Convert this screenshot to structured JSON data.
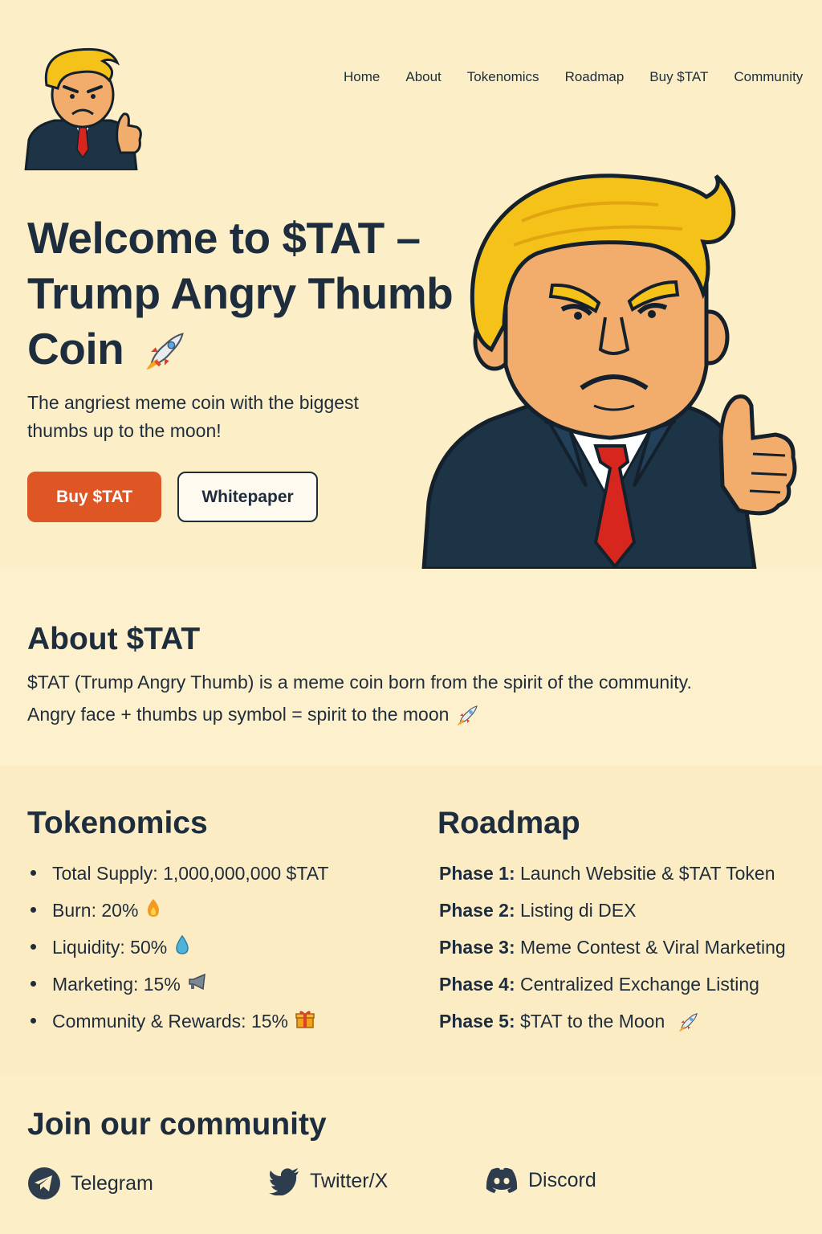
{
  "nav": {
    "items": [
      "Home",
      "About",
      "Tokenomics",
      "Roadmap",
      "Buy $TAT",
      "Community"
    ]
  },
  "hero": {
    "title": "Welcome to $TAT – Trump Angry Thumb Coin",
    "title_emoji": "rocket-icon",
    "subtitle": "The angriest meme coin with the biggest thumbs up to the moon!",
    "buy_label": "Buy $TAT",
    "whitepaper_label": "Whitepaper"
  },
  "about": {
    "heading": "About $TAT",
    "line1": "$TAT (Trump Angry Thumb) is a meme coin born from the spirit of the community.",
    "line2": "Angry face + thumbs up symbol = spirit to the moon"
  },
  "tokenomics": {
    "heading": "Tokenomics",
    "items": [
      {
        "text": "Total Supply: 1,000,000,000 $TAT",
        "icon": ""
      },
      {
        "text": "Burn: 20%",
        "icon": "fire-icon"
      },
      {
        "text": "Liquidity: 50%",
        "icon": "droplet-icon"
      },
      {
        "text": "Marketing: 15%",
        "icon": "megaphone-icon"
      },
      {
        "text": "Community & Rewards: 15%",
        "icon": "gift-icon"
      }
    ]
  },
  "roadmap": {
    "heading": "Roadmap",
    "phases": [
      {
        "label": "Phase 1:",
        "text": "Launch Websitie & $TAT Token"
      },
      {
        "label": "Phase 2:",
        "text": "Listing di DEX"
      },
      {
        "label": "Phase 3:",
        "text": "Meme Contest & Viral Marketing"
      },
      {
        "label": "Phase 4:",
        "text": "Centralized Exchange Listing"
      },
      {
        "label": "Phase 5:",
        "text": "$TAT to the Moon"
      }
    ]
  },
  "community": {
    "heading": "Join our community",
    "links": [
      "Telegram",
      "Twitter/X",
      "Discord"
    ]
  },
  "colors": {
    "background": "#fcefc8",
    "primary_button": "#de5624",
    "text": "#1d2d3e"
  }
}
